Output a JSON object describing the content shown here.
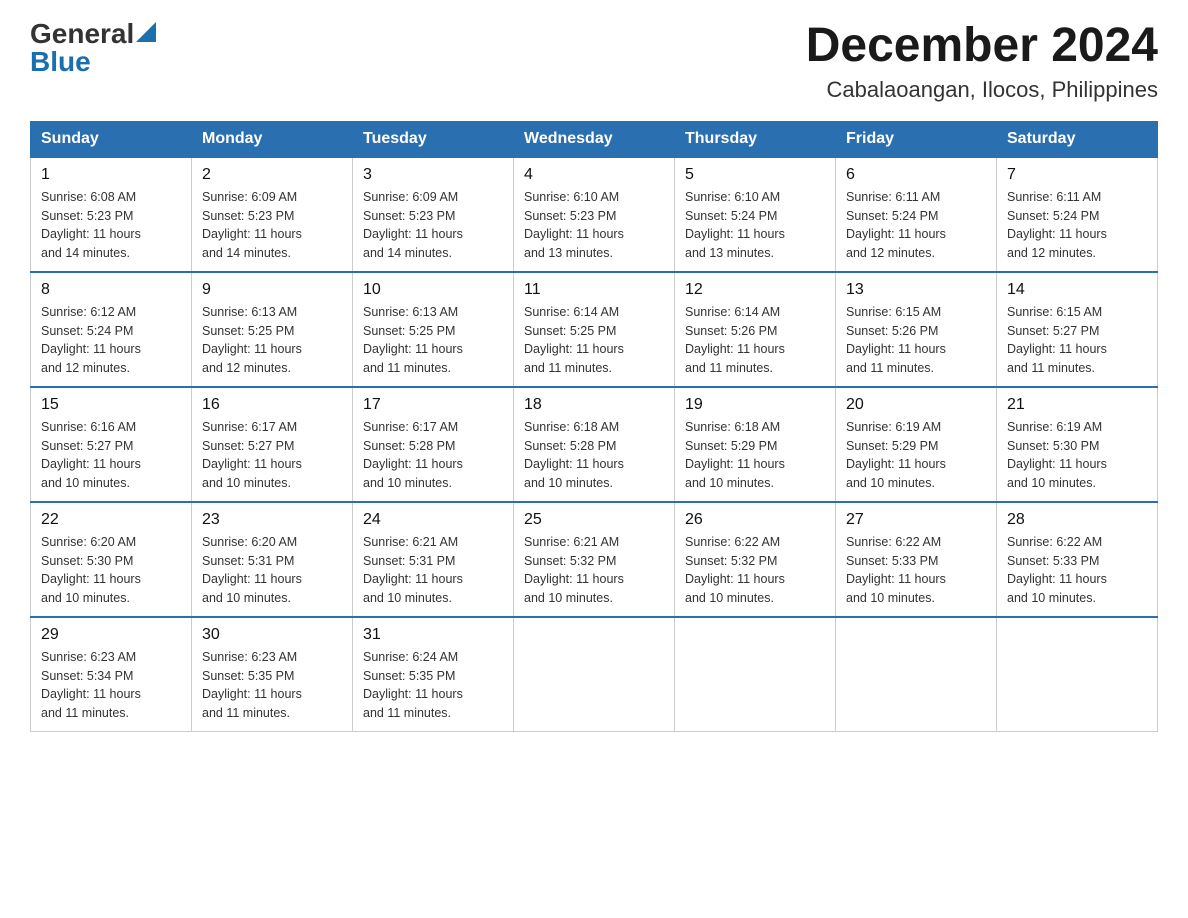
{
  "header": {
    "logo": {
      "general": "General",
      "blue": "Blue",
      "aria": "GeneralBlue logo"
    },
    "title": "December 2024",
    "location": "Cabalaoangan, Ilocos, Philippines"
  },
  "weekdays": [
    "Sunday",
    "Monday",
    "Tuesday",
    "Wednesday",
    "Thursday",
    "Friday",
    "Saturday"
  ],
  "weeks": [
    [
      {
        "day": "1",
        "sunrise": "6:08 AM",
        "sunset": "5:23 PM",
        "daylight": "11 hours and 14 minutes."
      },
      {
        "day": "2",
        "sunrise": "6:09 AM",
        "sunset": "5:23 PM",
        "daylight": "11 hours and 14 minutes."
      },
      {
        "day": "3",
        "sunrise": "6:09 AM",
        "sunset": "5:23 PM",
        "daylight": "11 hours and 14 minutes."
      },
      {
        "day": "4",
        "sunrise": "6:10 AM",
        "sunset": "5:23 PM",
        "daylight": "11 hours and 13 minutes."
      },
      {
        "day": "5",
        "sunrise": "6:10 AM",
        "sunset": "5:24 PM",
        "daylight": "11 hours and 13 minutes."
      },
      {
        "day": "6",
        "sunrise": "6:11 AM",
        "sunset": "5:24 PM",
        "daylight": "11 hours and 12 minutes."
      },
      {
        "day": "7",
        "sunrise": "6:11 AM",
        "sunset": "5:24 PM",
        "daylight": "11 hours and 12 minutes."
      }
    ],
    [
      {
        "day": "8",
        "sunrise": "6:12 AM",
        "sunset": "5:24 PM",
        "daylight": "11 hours and 12 minutes."
      },
      {
        "day": "9",
        "sunrise": "6:13 AM",
        "sunset": "5:25 PM",
        "daylight": "11 hours and 12 minutes."
      },
      {
        "day": "10",
        "sunrise": "6:13 AM",
        "sunset": "5:25 PM",
        "daylight": "11 hours and 11 minutes."
      },
      {
        "day": "11",
        "sunrise": "6:14 AM",
        "sunset": "5:25 PM",
        "daylight": "11 hours and 11 minutes."
      },
      {
        "day": "12",
        "sunrise": "6:14 AM",
        "sunset": "5:26 PM",
        "daylight": "11 hours and 11 minutes."
      },
      {
        "day": "13",
        "sunrise": "6:15 AM",
        "sunset": "5:26 PM",
        "daylight": "11 hours and 11 minutes."
      },
      {
        "day": "14",
        "sunrise": "6:15 AM",
        "sunset": "5:27 PM",
        "daylight": "11 hours and 11 minutes."
      }
    ],
    [
      {
        "day": "15",
        "sunrise": "6:16 AM",
        "sunset": "5:27 PM",
        "daylight": "11 hours and 10 minutes."
      },
      {
        "day": "16",
        "sunrise": "6:17 AM",
        "sunset": "5:27 PM",
        "daylight": "11 hours and 10 minutes."
      },
      {
        "day": "17",
        "sunrise": "6:17 AM",
        "sunset": "5:28 PM",
        "daylight": "11 hours and 10 minutes."
      },
      {
        "day": "18",
        "sunrise": "6:18 AM",
        "sunset": "5:28 PM",
        "daylight": "11 hours and 10 minutes."
      },
      {
        "day": "19",
        "sunrise": "6:18 AM",
        "sunset": "5:29 PM",
        "daylight": "11 hours and 10 minutes."
      },
      {
        "day": "20",
        "sunrise": "6:19 AM",
        "sunset": "5:29 PM",
        "daylight": "11 hours and 10 minutes."
      },
      {
        "day": "21",
        "sunrise": "6:19 AM",
        "sunset": "5:30 PM",
        "daylight": "11 hours and 10 minutes."
      }
    ],
    [
      {
        "day": "22",
        "sunrise": "6:20 AM",
        "sunset": "5:30 PM",
        "daylight": "11 hours and 10 minutes."
      },
      {
        "day": "23",
        "sunrise": "6:20 AM",
        "sunset": "5:31 PM",
        "daylight": "11 hours and 10 minutes."
      },
      {
        "day": "24",
        "sunrise": "6:21 AM",
        "sunset": "5:31 PM",
        "daylight": "11 hours and 10 minutes."
      },
      {
        "day": "25",
        "sunrise": "6:21 AM",
        "sunset": "5:32 PM",
        "daylight": "11 hours and 10 minutes."
      },
      {
        "day": "26",
        "sunrise": "6:22 AM",
        "sunset": "5:32 PM",
        "daylight": "11 hours and 10 minutes."
      },
      {
        "day": "27",
        "sunrise": "6:22 AM",
        "sunset": "5:33 PM",
        "daylight": "11 hours and 10 minutes."
      },
      {
        "day": "28",
        "sunrise": "6:22 AM",
        "sunset": "5:33 PM",
        "daylight": "11 hours and 10 minutes."
      }
    ],
    [
      {
        "day": "29",
        "sunrise": "6:23 AM",
        "sunset": "5:34 PM",
        "daylight": "11 hours and 11 minutes."
      },
      {
        "day": "30",
        "sunrise": "6:23 AM",
        "sunset": "5:35 PM",
        "daylight": "11 hours and 11 minutes."
      },
      {
        "day": "31",
        "sunrise": "6:24 AM",
        "sunset": "5:35 PM",
        "daylight": "11 hours and 11 minutes."
      },
      null,
      null,
      null,
      null
    ]
  ],
  "labels": {
    "sunrise": "Sunrise:",
    "sunset": "Sunset:",
    "daylight": "Daylight:"
  }
}
